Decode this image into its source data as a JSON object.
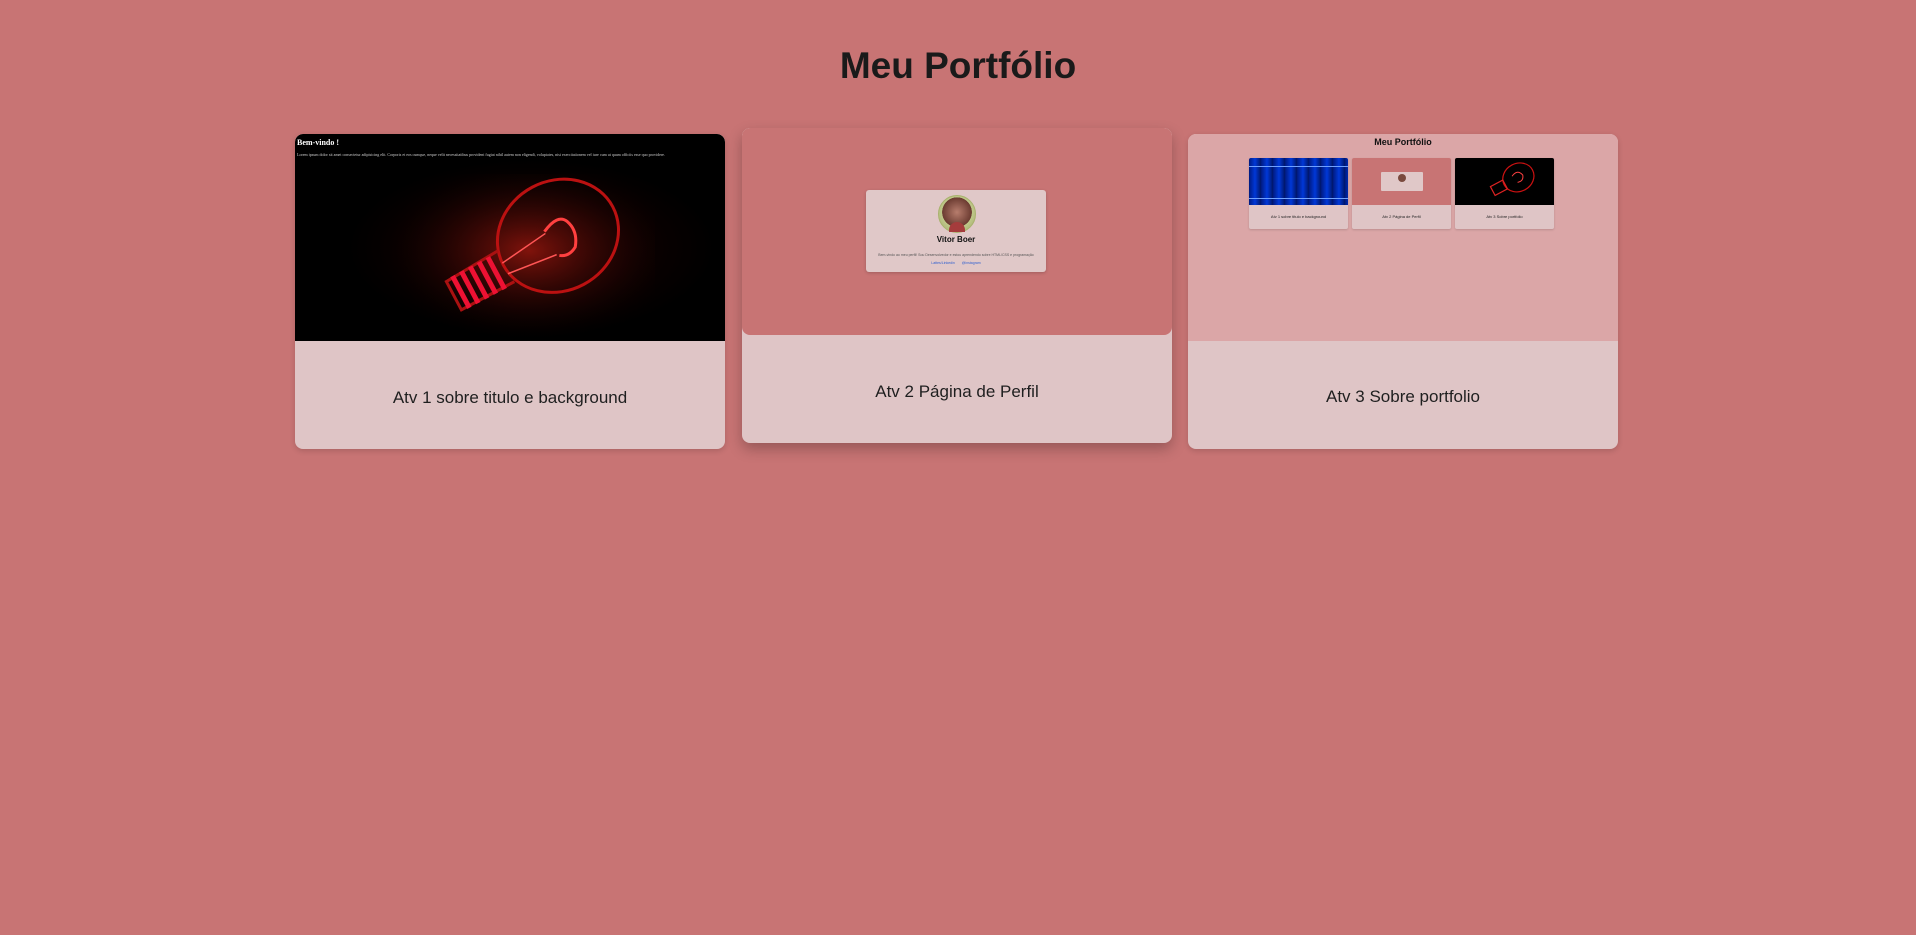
{
  "page": {
    "title": "Meu Portfólio"
  },
  "colors": {
    "background": "#c87474",
    "card": "#dfc5c6",
    "card_preview_3": "#dba6a7"
  },
  "projects": [
    {
      "caption": "Atv 1 sobre titulo e background",
      "preview": {
        "heading": "Bem-vindo !",
        "text": "Lorem ipsum dolor sit amet consectetur adipisicing elit. Corporis et eos cumque, neque velit necessitatibus provident fugiat nihil autem non eligendi, voluptates, nisi exercitationem vel iure cum ut quam officiis esse quo providere.",
        "image": "light-bulb-icon"
      }
    },
    {
      "caption": "Atv 2 Página de Perfil",
      "preview": {
        "name": "Vitor Boer",
        "bio": "Bem-vindo ao meu perfil! Sou Desenvolvedor e estou aprendendo sobre HTML/CSS e programação",
        "link_1": "Lattes/Linkedin",
        "link_2": "@instagram",
        "image": "avatar"
      }
    },
    {
      "caption": "Atv 3 Sobre portfolio",
      "preview": {
        "title": "Meu Portfólio",
        "items": [
          {
            "caption": "Atv 1 sobre titulo e background"
          },
          {
            "caption": "Atv 2 Página de Perfil"
          },
          {
            "caption": "Atv 3 Sobre portfolio"
          }
        ]
      }
    }
  ]
}
